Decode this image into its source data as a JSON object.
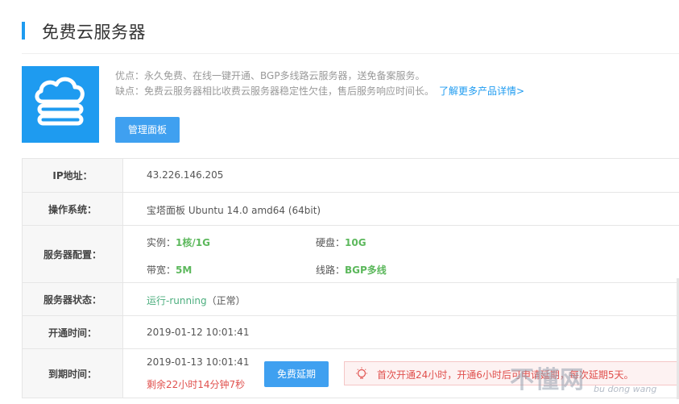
{
  "header": {
    "title": "免费云服务器"
  },
  "intro": {
    "pros": "优点：永久免费、在线一键开通、BGP多线路云服务器，送免备案服务。",
    "cons": "缺点：免费云服务器相比收费云服务器稳定性欠佳，售后服务响应时间长。",
    "learn_more": "了解更多产品详情>",
    "manage_button": "管理面板",
    "icon": "cloud-server-icon"
  },
  "rows": {
    "ip": {
      "label": "IP地址：",
      "value": "43.226.146.205"
    },
    "os": {
      "label": "操作系统：",
      "value": "宝塔面板 Ubuntu 14.0 amd64 (64bit)"
    },
    "config": {
      "label": "服务器配置：",
      "instance_key": "实例：",
      "instance_val": "1核/1G",
      "disk_key": "硬盘：",
      "disk_val": "10G",
      "bandwidth_key": "带宽：",
      "bandwidth_val": "5M",
      "line_key": "线路：",
      "line_val": "BGP多线"
    },
    "state": {
      "label": "服务器状态：",
      "running": "运行-running",
      "normal": "（正常）"
    },
    "open_time": {
      "label": "开通时间：",
      "value": "2019-01-12 10:01:41"
    },
    "expire": {
      "label": "到期时间：",
      "value": "2019-01-13 10:01:41",
      "remaining": "剩余22小时14分钟7秒",
      "extend_button": "免费延期",
      "notice": "首次开通24小时，开通6小时后可申请延期，每次延期5天。"
    }
  },
  "watermark": {
    "main": "不懂网",
    "sub": "bu dong wang"
  },
  "colors": {
    "accent": "#1e9bf0",
    "green": "#5cb85c",
    "red": "#e0504d"
  }
}
